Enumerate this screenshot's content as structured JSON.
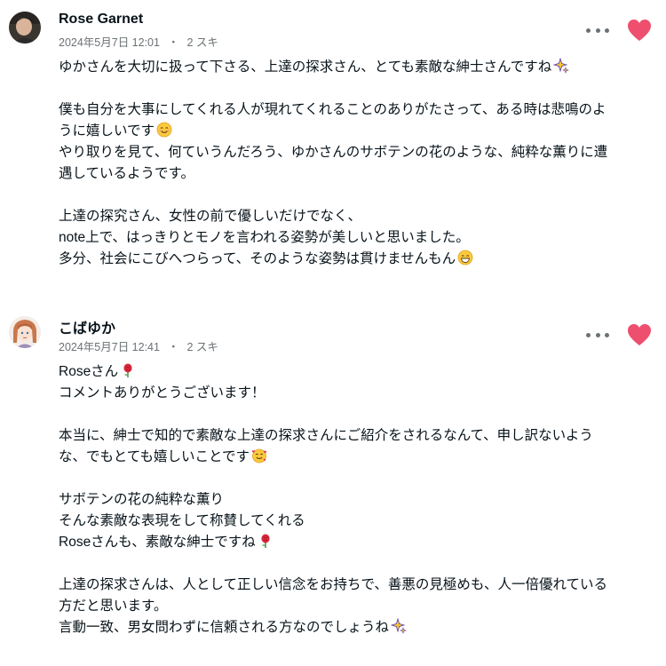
{
  "comments": [
    {
      "author": "Rose Garnet",
      "date": "2024年5月7日 12:01",
      "dot": "・",
      "likes": "2 スキ",
      "lines": [
        "ゆかさんを大切に扱って下さる、上達の探求さん、とても素敵な紳士さんですね",
        "",
        "僕も自分を大事にしてくれる人が現れてくれることのありがたさって、ある時は悲鳴のよ",
        "うに嬉しいです",
        "やり取りを見て、何ていうんだろう、ゆかさんのサボテンの花のような、純粋な薫りに遭",
        "遇しているようです。",
        "",
        "上達の探究さん、女性の前で優しいだけでなく、",
        "note上で、はっきりとモノを言われる姿勢が美しいと思いました。",
        "多分、社会にこびへつらって、そのような姿勢は貫けませんもん"
      ]
    },
    {
      "author": "こばゆか",
      "date": "2024年5月7日 12:41",
      "dot": "・",
      "likes": "2 スキ",
      "lines": [
        "Roseさん",
        "コメントありがとうございます！",
        "",
        "本当に、紳士で知的で素敵な上達の探求さんにご紹介をされるなんて、申し訳ないよう",
        "な、でもとても嬉しいことです",
        "",
        "サボテンの花の純粋な薫り",
        "そんな素敵な表現をして称賛してくれる",
        "Roseさんも、素敵な紳士ですね",
        "",
        "上達の探求さんは、人として正しい信念をお持ちで、善悪の見極めも、人一倍優れている",
        "方だと思います。",
        "言動一致、男女問わずに信頼される方なのでしょうね"
      ]
    }
  ],
  "icons": {
    "more": "more-options-icon",
    "like": "heart-icon",
    "sparkles": "sparkles-emoji",
    "smile": "smiling-face-emoji",
    "grin": "grinning-face-emoji",
    "rose": "rose-emoji",
    "hearts_face": "smiling-face-with-hearts-emoji"
  },
  "colors": {
    "heart": "#ee4f6f",
    "text": "#08131a",
    "meta": "#6b7275"
  }
}
